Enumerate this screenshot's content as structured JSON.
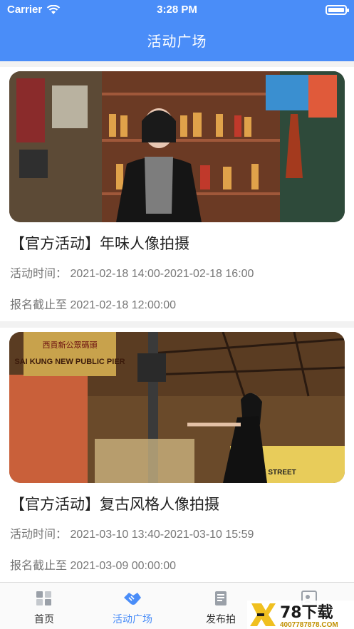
{
  "status_bar": {
    "carrier": "Carrier",
    "time": "3:28 PM"
  },
  "header": {
    "title": "活动广场"
  },
  "activities": [
    {
      "title": "【官方活动】年味人像拍摄",
      "time": "活动时间：  2021-02-18 14:00-2021-02-18 16:00",
      "deadline": "报名截止至  2021-02-18 12:00:00",
      "image": "portrait-in-shop-photo"
    },
    {
      "title": "【官方活动】复古风格人像拍摄",
      "time": "活动时间：  2021-03-10 13:40-2021-03-10 15:59",
      "deadline": "报名截止至  2021-03-09 00:00:00",
      "image": "retro-street-portrait-photo",
      "sign_text_1": "西貢新公眾碼頭",
      "sign_text_2": "SAI KUNG NEW PUBLIC PIER",
      "sign_text_3": "TEMPLE STREET"
    }
  ],
  "tabbar": {
    "tabs": [
      {
        "label": "首页",
        "icon": "home-grid-icon"
      },
      {
        "label": "活动广场",
        "icon": "handshake-icon",
        "active": true
      },
      {
        "label": "发布拍",
        "icon": "publish-doc-icon"
      },
      {
        "label": "",
        "icon": "profile-card-icon"
      }
    ]
  },
  "watermark": {
    "logo_text": "78下载",
    "url": "4007787878.COM"
  },
  "colors": {
    "primary": "#4a8df8",
    "text_main": "#222222",
    "text_sub": "#777777"
  }
}
